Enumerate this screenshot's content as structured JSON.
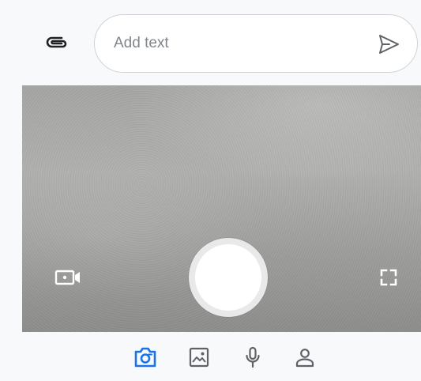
{
  "compose": {
    "placeholder": "Add text",
    "value": "",
    "attach_icon": "paperclip-icon",
    "send_icon": "send-icon"
  },
  "camera": {
    "video_mode_icon": "video-camera-icon",
    "shutter": "shutter-button",
    "fullscreen_icon": "fullscreen-icon"
  },
  "tabs": [
    {
      "icon": "camera-icon",
      "active": true
    },
    {
      "icon": "image-icon",
      "active": false
    },
    {
      "icon": "microphone-icon",
      "active": false
    },
    {
      "icon": "contact-icon",
      "active": false
    }
  ],
  "colors": {
    "active_tab": "#1a73e8",
    "inactive_icon": "#5f6368",
    "attach_icon": "#202124",
    "send_icon": "#5f6368"
  }
}
